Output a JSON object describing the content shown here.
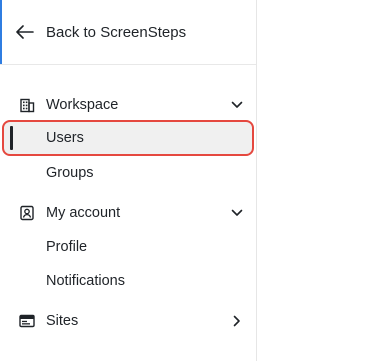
{
  "nav": {
    "back_label": "Back to ScreenSteps",
    "sections": {
      "workspace": {
        "label": "Workspace",
        "icon": "building-icon",
        "expanded": true,
        "items": [
          {
            "label": "Users",
            "selected": true
          },
          {
            "label": "Groups",
            "selected": false
          }
        ]
      },
      "account": {
        "label": "My account",
        "icon": "user-card-icon",
        "expanded": true,
        "items": [
          {
            "label": "Profile",
            "selected": false
          },
          {
            "label": "Notifications",
            "selected": false
          }
        ]
      },
      "sites": {
        "label": "Sites",
        "icon": "window-icon",
        "expanded": false
      }
    }
  },
  "colors": {
    "accent_blue": "#2f7de1",
    "highlight_red": "#e5483f",
    "selected_bg": "#f0f0f0",
    "text": "#1f2328"
  }
}
